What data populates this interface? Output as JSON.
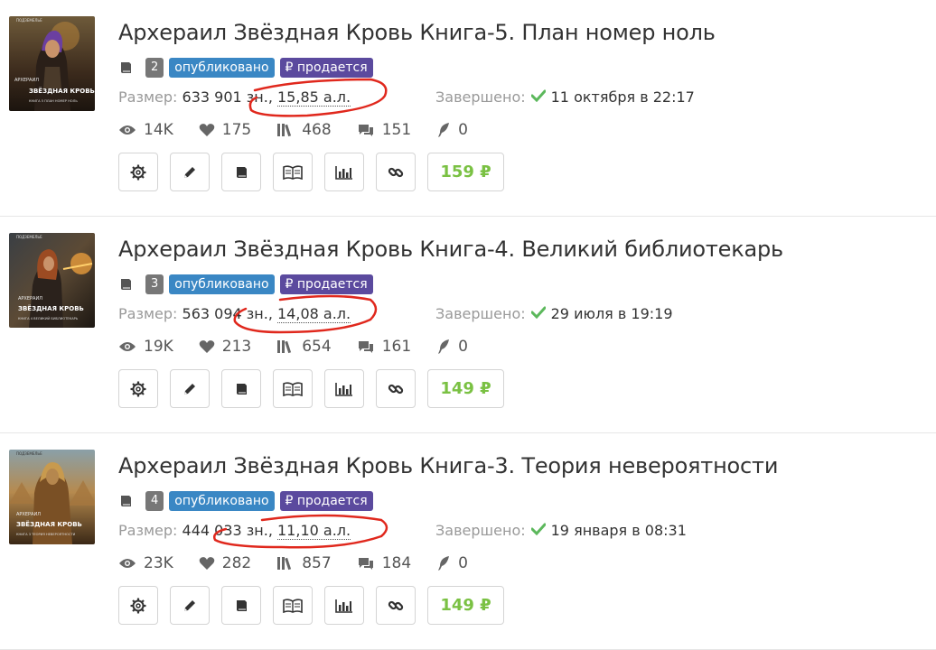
{
  "labels": {
    "size_prefix": "Размер:",
    "completed_prefix": "Завершено:"
  },
  "colors": {
    "published_badge": "#3a87c4",
    "on_sale_badge": "#5b4a9e",
    "price_text": "#7ac143",
    "completed_check": "#5cb85c",
    "annotation": "#e0281d"
  },
  "icons": {
    "type": "book-icon",
    "views": "eye-icon",
    "likes": "heart-icon",
    "library": "library-icon",
    "comments": "comments-icon",
    "awards": "feather-icon",
    "actions": [
      "gear-icon",
      "pencil-icon",
      "book-icon",
      "open-book-icon",
      "bar-chart-icon",
      "link-icon"
    ]
  },
  "books": [
    {
      "title": "Архераил Звёздная Кровь Книга-5. План номер ноль",
      "number": "2",
      "status_badge": "опубликовано",
      "sale_badge": "₽ продается",
      "size_chars": "633 901 зн.",
      "size_sheets": "15,85 а.л.",
      "completed_date": "11 октября в 22:17",
      "views": "14K",
      "likes": "175",
      "library": "468",
      "comments": "151",
      "awards": "0",
      "price": "159 ₽",
      "cover": {
        "top_text": "ПОДЗЕМЕЛЬЕ",
        "author": "АРХЕРАИЛ",
        "series": "ЗВЁЗДНАЯ КРОВЬ",
        "subtitle": "КНИГА 5 ПЛАН НОМЕР НОЛЬ"
      }
    },
    {
      "title": "Архераил Звёздная Кровь Книга-4. Великий библиотекарь",
      "number": "3",
      "status_badge": "опубликовано",
      "sale_badge": "₽ продается",
      "size_chars": "563 094 зн.",
      "size_sheets": "14,08 а.л.",
      "completed_date": "29 июля в 19:19",
      "views": "19K",
      "likes": "213",
      "library": "654",
      "comments": "161",
      "awards": "0",
      "price": "149 ₽",
      "cover": {
        "top_text": "ПОДЗЕМЕЛЬЕ",
        "author": "АРХЕРАИЛ",
        "series": "ЗВЁЗДНАЯ КРОВЬ",
        "subtitle": "КНИГА 4 ВЕЛИКИЙ БИБЛИОТЕКАРЬ"
      }
    },
    {
      "title": "Архераил Звёздная Кровь Книга-3. Теория невероятности",
      "number": "4",
      "status_badge": "опубликовано",
      "sale_badge": "₽ продается",
      "size_chars": "444 033 зн.",
      "size_sheets": "11,10 а.л.",
      "completed_date": "19 января в 08:31",
      "views": "23K",
      "likes": "282",
      "library": "857",
      "comments": "184",
      "awards": "0",
      "price": "149 ₽",
      "cover": {
        "top_text": "ПОДЗЕМЕЛЬЕ",
        "author": "АРХЕРАИЛ",
        "series": "ЗВЁЗДНАЯ КРОВЬ",
        "subtitle": "КНИГА 3 ТЕОРИЯ НЕВЕРОЯТНОСТИ"
      }
    }
  ]
}
